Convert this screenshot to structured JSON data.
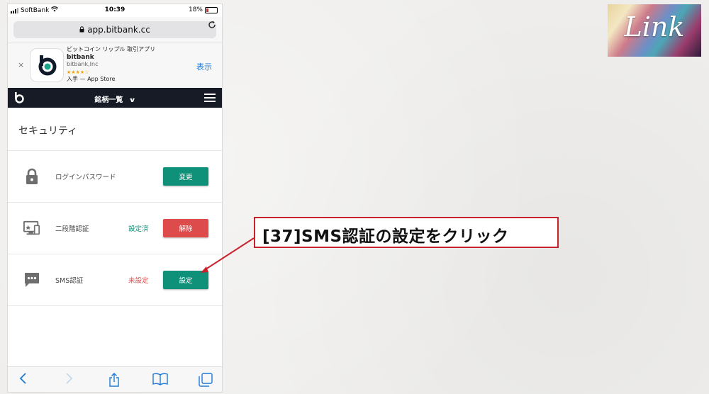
{
  "status_bar": {
    "carrier": "SoftBank",
    "time": "10:39",
    "battery": "18%"
  },
  "url_bar": {
    "url": "app.bitbank.cc"
  },
  "app_banner": {
    "close": "×",
    "description": "ビットコイン リップル 取引アプリ",
    "name": "bitbank",
    "company": "bitbank,Inc",
    "stars": "★★★★☆",
    "source": "入手 — App Store",
    "view_label": "表示"
  },
  "header": {
    "title": "銘柄一覧",
    "chevron": "∨"
  },
  "security": {
    "title": "セキュリティ",
    "rows": [
      {
        "label": "ログインパスワード",
        "status": "",
        "button": "変更",
        "icon": "lock-icon"
      },
      {
        "label": "二段階認証",
        "status": "設定済",
        "status_color": "#0e9079",
        "button": "解除",
        "icon": "two-factor-icon"
      },
      {
        "label": "SMS認証",
        "status": "未設定",
        "status_color": "#dd4b4b",
        "button": "設定",
        "icon": "sms-icon"
      }
    ]
  },
  "callout": {
    "text": "[37]SMS認証の設定をクリック"
  },
  "logo": {
    "text": "Link"
  },
  "colors": {
    "green": "#0e9079",
    "red": "#dd4b4b",
    "header_bg": "#161b26",
    "ios_blue": "#1e7ad6",
    "callout_border": "#c8232c"
  }
}
